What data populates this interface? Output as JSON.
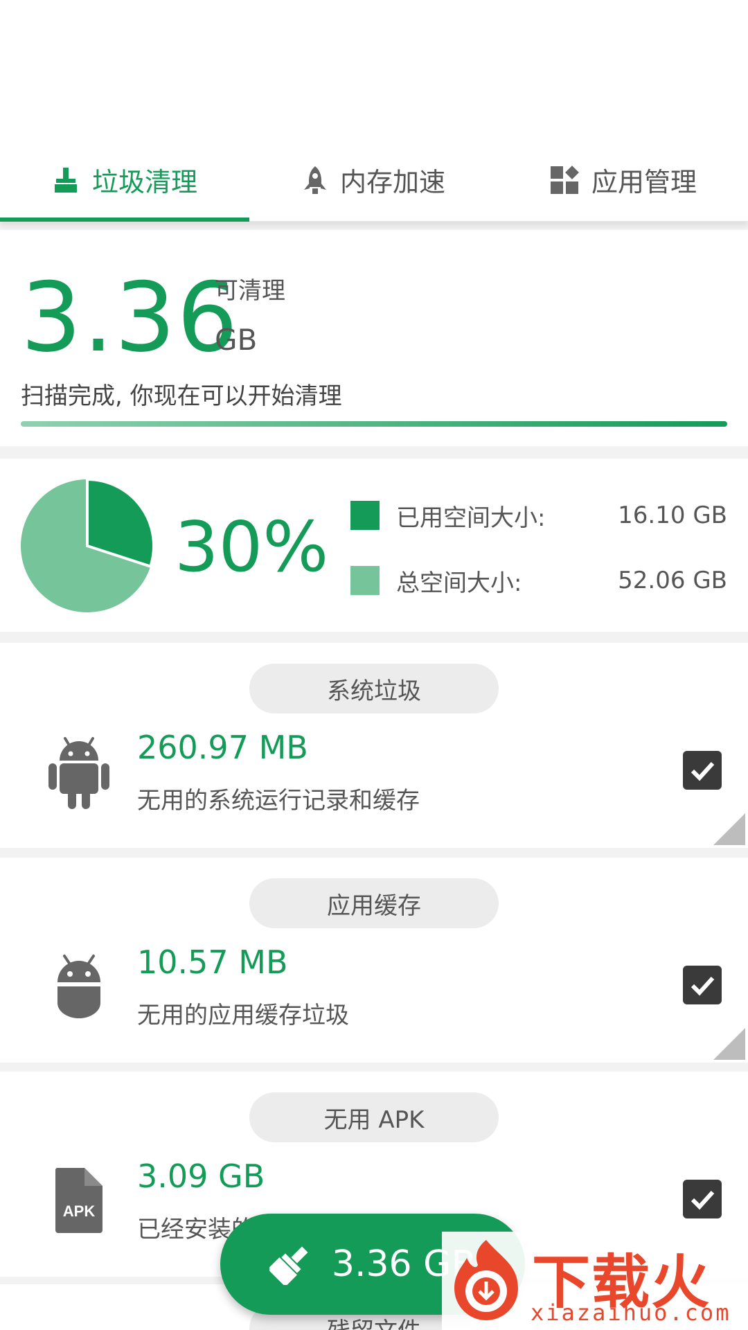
{
  "tabs": [
    {
      "label": "垃圾清理",
      "icon": "broom-icon",
      "active": true
    },
    {
      "label": "内存加速",
      "icon": "rocket-icon",
      "active": false
    },
    {
      "label": "应用管理",
      "icon": "apps-grid-icon",
      "active": false
    }
  ],
  "summary": {
    "amount": "3.36",
    "label": "可清理",
    "unit": "GB",
    "status": "扫描完成, 你现在可以开始清理"
  },
  "storage": {
    "percent_label": "30%",
    "used_fraction": 0.3,
    "used_label": "已用空间大小:",
    "used_value": "16.10 GB",
    "total_label": "总空间大小:",
    "total_value": "52.06 GB"
  },
  "items": [
    {
      "title": "系统垃圾",
      "size": "260.97 MB",
      "desc": "无用的系统运行记录和缓存",
      "icon": "android-robot-icon",
      "checked": true
    },
    {
      "title": "应用缓存",
      "size": "10.57 MB",
      "desc": "无用的应用缓存垃圾",
      "icon": "android-head-icon",
      "checked": true
    },
    {
      "title": "无用 APK",
      "size": "3.09 GB",
      "desc": "已经安装的",
      "icon": "apk-file-icon",
      "checked": true
    },
    {
      "title": "残留文件"
    }
  ],
  "fab": {
    "label": "3.36 GB",
    "icon": "clean-brush-icon"
  },
  "watermark": {
    "text": "下载火",
    "sub": "xiazaihuo.com"
  },
  "colors": {
    "accent": "#139b57",
    "accent_light": "#76c49a",
    "checkbox": "#3a3a3a",
    "pill": "#ececec"
  }
}
